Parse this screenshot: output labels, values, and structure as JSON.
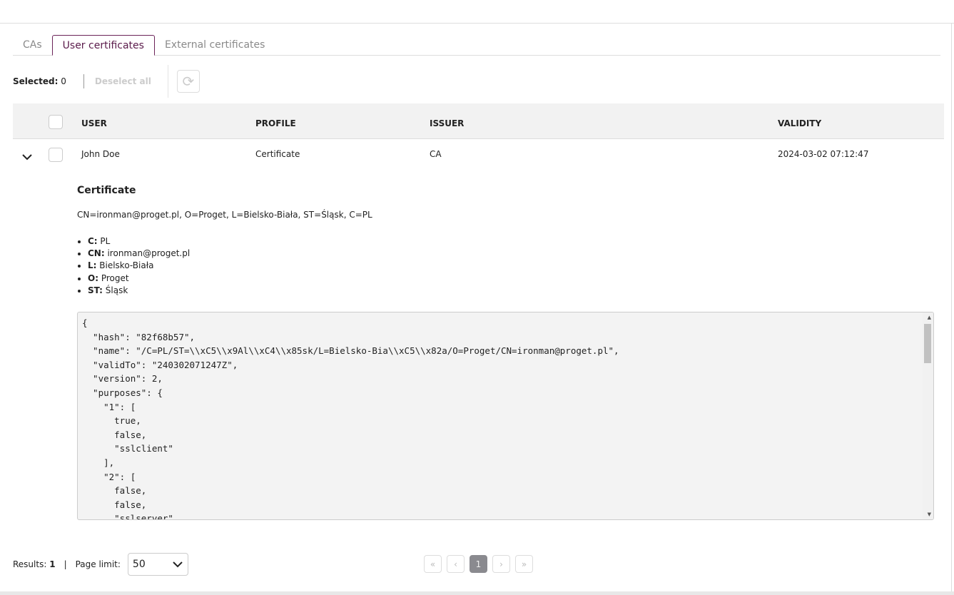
{
  "tabs": [
    {
      "label": "CAs"
    },
    {
      "label": "User certificates",
      "active": true
    },
    {
      "label": "External certificates"
    }
  ],
  "toolbar": {
    "selected_label": "Selected:",
    "selected_count": "0",
    "deselect_label": "Deselect all",
    "refresh_icon": "refresh-icon"
  },
  "table": {
    "headers": {
      "user": "USER",
      "profile": "PROFILE",
      "issuer": "ISSUER",
      "validity": "VALIDITY"
    },
    "rows": [
      {
        "user": "John Doe",
        "profile": "Certificate",
        "issuer": "CA",
        "validity": "2024-03-02 07:12:47",
        "expanded": true
      }
    ]
  },
  "detail": {
    "title": "Certificate",
    "dn": "CN=ironman@proget.pl, O=Proget, L=Bielsko-Biała, ST=Śląsk, C=PL",
    "attrs": [
      {
        "k": "C:",
        "v": " PL"
      },
      {
        "k": "CN:",
        "v": " ironman@proget.pl"
      },
      {
        "k": "L:",
        "v": " Bielsko-Biała"
      },
      {
        "k": "O:",
        "v": " Proget"
      },
      {
        "k": "ST:",
        "v": " Śląsk"
      }
    ],
    "code_lines": [
      "{",
      "  \"hash\": \"82f68b57\",",
      "  \"name\": \"/C=PL/ST=\\\\xC5\\\\x9Al\\\\xC4\\\\x85sk/L=Bielsko-Bia\\\\xC5\\\\x82a/O=Proget/CN=ironman@proget.pl\",",
      "  \"validTo\": \"240302071247Z\",",
      "  \"version\": 2,",
      "  \"purposes\": {",
      "    \"1\": [",
      "      true,",
      "      false,",
      "      \"sslclient\"",
      "    ],",
      "    \"2\": [",
      "      false,",
      "      false,",
      "      \"sslserver\""
    ]
  },
  "footer": {
    "results_label": "Results:",
    "results_count": "1",
    "sep": "|",
    "page_limit_label": "Page limit:",
    "page_limit_value": "50",
    "pager": {
      "first": "«",
      "prev": "‹",
      "current": "1",
      "next": "›",
      "last": "»"
    }
  },
  "colors": {
    "accent": "#6b2358",
    "header_bg": "#f2f2f2",
    "code_bg": "#f3f3f3",
    "current_page": "#8a8a8f"
  }
}
